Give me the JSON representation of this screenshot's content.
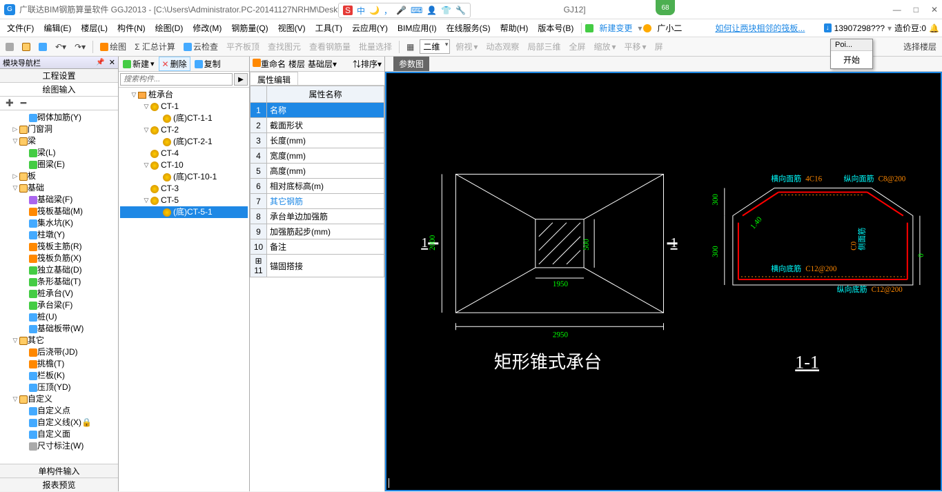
{
  "title": "广联达BIM钢筋算量软件 GGJ2013 - [C:\\Users\\Administrator.PC-20141127NRHM\\Desktop\\白杰",
  "title_suffix": "GJ12]",
  "ime": {
    "s": "S",
    "zhong": "中",
    "moon": "🌙",
    "comma": "，",
    "mic": "🎤",
    "kb": "⌨",
    "shirt": "👕",
    "user": "👤",
    "wrench": "🔧"
  },
  "badge68": "68",
  "menus": [
    "文件(F)",
    "编辑(E)",
    "楼层(L)",
    "构件(N)",
    "绘图(D)",
    "修改(M)",
    "钢筋量(Q)",
    "视图(V)",
    "工具(T)",
    "云应用(Y)",
    "BIM应用(I)",
    "在线服务(S)",
    "帮助(H)",
    "版本号(B)"
  ],
  "new_change": "新建变更",
  "user_gx": "广小二",
  "news": "如何让两块相邻的筏板...",
  "acct": "13907298???",
  "coin": "造价豆:0",
  "popup": {
    "hdr": "Poi...",
    "btn": "开始"
  },
  "tb1": {
    "draw": "绘图",
    "sum": "Σ 汇总计算",
    "cloud": "云检查",
    "align": "平齐板顶",
    "findimg": "查找图元",
    "viewreb": "查看钢筋量",
    "batch": "批量选择",
    "two": "二维",
    "top": "俯视",
    "dyn": "动态观察",
    "local3d": "局部三维",
    "full": "全屏",
    "zoom": "缩放",
    "pan": "平移",
    "scr": "屏",
    "sel": "选择楼层"
  },
  "tb2": {
    "new": "新建",
    "del": "删除",
    "copy": "复制",
    "ren": "重命名",
    "floor": "楼层",
    "base": "基础层",
    "sort": "排序"
  },
  "nav": {
    "hdr": "模块导航栏",
    "tabs": [
      "工程设置",
      "绘图输入"
    ],
    "foot": [
      "单构件输入",
      "报表预览"
    ]
  },
  "tree": [
    {
      "d": 2,
      "ic": "blue",
      "t": "砌体加筋(Y)"
    },
    {
      "d": 1,
      "tw": "▷",
      "ic": "folder",
      "t": "门窗洞"
    },
    {
      "d": 1,
      "tw": "▽",
      "ic": "folder",
      "t": "梁"
    },
    {
      "d": 2,
      "ic": "green",
      "t": "梁(L)"
    },
    {
      "d": 2,
      "ic": "green",
      "t": "圈梁(E)"
    },
    {
      "d": 1,
      "tw": "▷",
      "ic": "folder",
      "t": "板"
    },
    {
      "d": 1,
      "tw": "▽",
      "ic": "folder",
      "t": "基础"
    },
    {
      "d": 2,
      "ic": "purple",
      "t": "基础梁(F)"
    },
    {
      "d": 2,
      "ic": "orange",
      "t": "筏板基础(M)"
    },
    {
      "d": 2,
      "ic": "blue",
      "t": "集水坑(K)"
    },
    {
      "d": 2,
      "ic": "blue",
      "t": "柱墩(Y)"
    },
    {
      "d": 2,
      "ic": "orange",
      "t": "筏板主筋(R)"
    },
    {
      "d": 2,
      "ic": "orange",
      "t": "筏板负筋(X)"
    },
    {
      "d": 2,
      "ic": "green",
      "t": "独立基础(D)"
    },
    {
      "d": 2,
      "ic": "green",
      "t": "条形基础(T)"
    },
    {
      "d": 2,
      "ic": "green",
      "t": "桩承台(V)",
      "hl": true
    },
    {
      "d": 2,
      "ic": "green",
      "t": "承台梁(F)"
    },
    {
      "d": 2,
      "ic": "blue",
      "t": "桩(U)"
    },
    {
      "d": 2,
      "ic": "blue",
      "t": "基础板带(W)"
    },
    {
      "d": 1,
      "tw": "▽",
      "ic": "folder",
      "t": "其它"
    },
    {
      "d": 2,
      "ic": "orange",
      "t": "后浇带(JD)"
    },
    {
      "d": 2,
      "ic": "orange",
      "t": "挑檐(T)"
    },
    {
      "d": 2,
      "ic": "blue",
      "t": "栏板(K)"
    },
    {
      "d": 2,
      "ic": "blue",
      "t": "压顶(YD)"
    },
    {
      "d": 1,
      "tw": "▽",
      "ic": "folder",
      "t": "自定义"
    },
    {
      "d": 2,
      "ic": "blue",
      "t": "自定义点"
    },
    {
      "d": 2,
      "ic": "blue",
      "t": "自定义线(X)🔒"
    },
    {
      "d": 2,
      "ic": "blue",
      "t": "自定义面"
    },
    {
      "d": 2,
      "ic": "gray",
      "t": "尺寸标注(W)"
    }
  ],
  "search_ph": "搜索构件...",
  "comp": [
    {
      "d": 0,
      "tw": "▽",
      "shape": true,
      "t": "桩承台"
    },
    {
      "d": 1,
      "tw": "▽",
      "gear": true,
      "t": "CT-1"
    },
    {
      "d": 2,
      "gear": true,
      "t": "(底)CT-1-1"
    },
    {
      "d": 1,
      "tw": "▽",
      "gear": true,
      "t": "CT-2"
    },
    {
      "d": 2,
      "gear": true,
      "t": "(底)CT-2-1"
    },
    {
      "d": 1,
      "gear": true,
      "t": "CT-4"
    },
    {
      "d": 1,
      "tw": "▽",
      "gear": true,
      "t": "CT-10"
    },
    {
      "d": 2,
      "gear": true,
      "t": "(底)CT-10-1"
    },
    {
      "d": 1,
      "gear": true,
      "t": "CT-3"
    },
    {
      "d": 1,
      "tw": "▽",
      "gear": true,
      "t": "CT-5"
    },
    {
      "d": 2,
      "gear": true,
      "t": "(底)CT-5-1",
      "sel": true
    }
  ],
  "prop": {
    "tab": "属性编辑",
    "header": "属性名称",
    "rows": [
      {
        "n": "1",
        "v": "名称",
        "sel": true
      },
      {
        "n": "2",
        "v": "截面形状"
      },
      {
        "n": "3",
        "v": "长度(mm)"
      },
      {
        "n": "4",
        "v": "宽度(mm)"
      },
      {
        "n": "5",
        "v": "高度(mm)"
      },
      {
        "n": "6",
        "v": "相对底标高(m)"
      },
      {
        "n": "7",
        "v": "其它钢筋",
        "blue": true
      },
      {
        "n": "8",
        "v": "承台单边加强筋"
      },
      {
        "n": "9",
        "v": "加强筋起步(mm)"
      },
      {
        "n": "10",
        "v": "备注"
      },
      {
        "n": "11",
        "v": "锚固搭接",
        "exp": "+"
      }
    ]
  },
  "canvas": {
    "hdr_tab": "参数图",
    "title_left": "矩形锥式承台",
    "title_right": "1-1",
    "dim_2950": "2950",
    "dim_1950": "1950",
    "dim_2000": "2000",
    "dim_500": "500",
    "dim_300a": "300",
    "dim_300b": "300",
    "dim_140": "1.40",
    "l1": "1",
    "l2": "1",
    "hx_top": "横向面筋",
    "hx_top_v": "4C16",
    "zx_top": "纵向面筋",
    "zx_top_v": "C8@200",
    "hx_bot": "横向底筋",
    "hx_bot_v": "C12@200",
    "zx_bot": "纵向底筋",
    "zx_bot_v": "C12@200",
    "side": "侧面筋",
    "side_v": "C0",
    "zero": "0"
  }
}
